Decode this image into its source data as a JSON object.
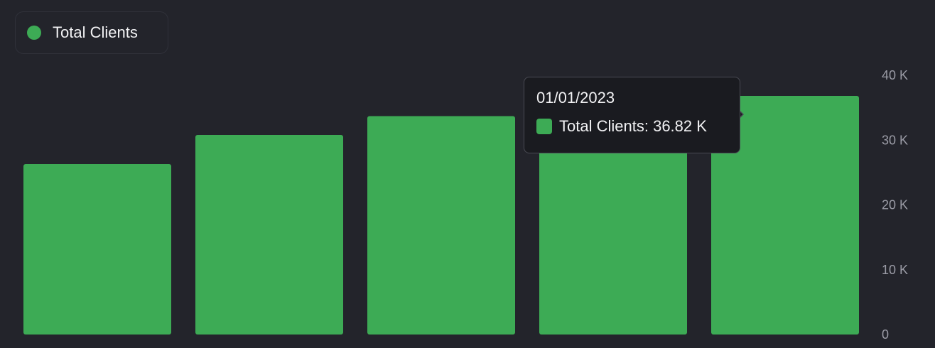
{
  "legend": {
    "label": "Total Clients",
    "color": "#3dab55"
  },
  "tooltip": {
    "date": "01/01/2023",
    "series_label": "Total Clients",
    "value_text": "36.82 K"
  },
  "chart_data": {
    "type": "bar",
    "series": [
      {
        "name": "Total Clients",
        "color": "#3dab55",
        "values": [
          26300,
          30800,
          33700,
          33700,
          36820
        ]
      }
    ],
    "ylim": [
      0,
      40000
    ],
    "yticks": [
      {
        "value": 0,
        "label": "0"
      },
      {
        "value": 10000,
        "label": "10 K"
      },
      {
        "value": 20000,
        "label": "20 K"
      },
      {
        "value": 30000,
        "label": "30 K"
      },
      {
        "value": 40000,
        "label": "40 K"
      }
    ],
    "y_axis_position": "right",
    "grid": false,
    "legend_position": "top-left"
  }
}
